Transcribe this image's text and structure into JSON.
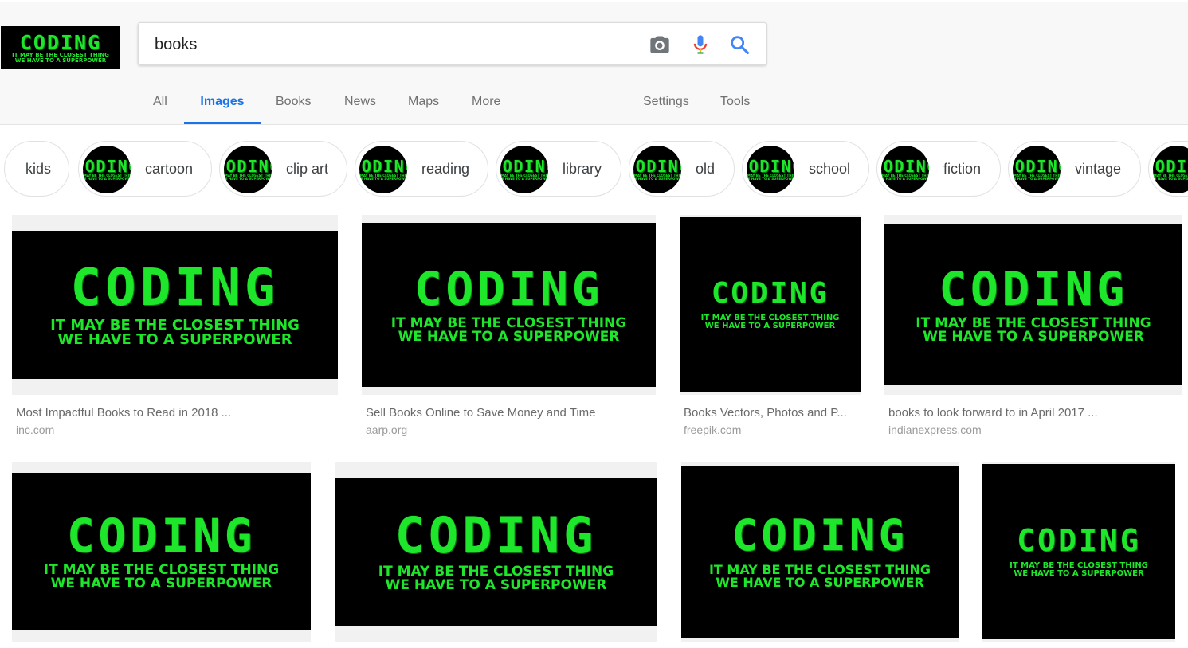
{
  "logo": {
    "big": "CODING",
    "line1": "IT MAY BE THE CLOSEST THING",
    "line2": "WE HAVE TO A SUPERPOWER"
  },
  "search": {
    "query": "books"
  },
  "tabs": [
    "All",
    "Images",
    "Books",
    "News",
    "Maps",
    "More",
    "Settings",
    "Tools"
  ],
  "active_tab": "Images",
  "chips": [
    "kids",
    "cartoon",
    "clip art",
    "reading",
    "library",
    "old",
    "school",
    "fiction",
    "vintage"
  ],
  "banner": {
    "big": "CODING",
    "line1": "IT MAY BE THE CLOSEST THING",
    "line2": "WE HAVE TO A SUPERPOWER"
  },
  "results": [
    {
      "title": "Most Impactful Books to Read in 2018 ...",
      "source": "inc.com"
    },
    {
      "title": "Sell Books Online to Save Money and Time",
      "source": "aarp.org"
    },
    {
      "title": "Books Vectors, Photos and P...",
      "source": "freepik.com"
    },
    {
      "title": "books to look forward to in April 2017 ...",
      "source": "indianexpress.com"
    },
    {
      "title": "",
      "source": ""
    },
    {
      "title": "",
      "source": ""
    },
    {
      "title": "",
      "source": ""
    },
    {
      "title": "",
      "source": ""
    }
  ],
  "colors": {
    "accent": "#1a73e8",
    "banner_green": "#1ee62a",
    "banner_bg": "#000000"
  },
  "icons": [
    "camera-icon",
    "microphone-icon",
    "search-icon"
  ]
}
